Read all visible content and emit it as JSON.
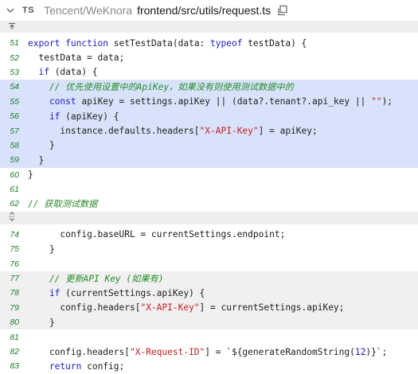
{
  "header": {
    "lang_badge": "TS",
    "repo": "Tencent/WeKnora",
    "path": "frontend/src/utils/request.ts"
  },
  "code": [
    {
      "num": "51",
      "hl": "none",
      "segs": [
        [
          "kw",
          "export function "
        ],
        [
          "",
          "setTestData(data: "
        ],
        [
          "kw",
          "typeof"
        ],
        [
          "",
          " testData) {"
        ]
      ]
    },
    {
      "num": "52",
      "hl": "none",
      "segs": [
        [
          "",
          "  testData = data;"
        ]
      ]
    },
    {
      "num": "53",
      "hl": "none",
      "segs": [
        [
          "kw",
          "  if"
        ],
        [
          "",
          " (data) {"
        ]
      ]
    },
    {
      "num": "54",
      "hl": "blue",
      "segs": [
        [
          "cm",
          "    // 优先使用设置中的ApiKey，如果没有则使用测试数据中的"
        ]
      ]
    },
    {
      "num": "55",
      "hl": "blue",
      "segs": [
        [
          "kw",
          "    const"
        ],
        [
          "",
          " apiKey = settings.apiKey || (data?.tenant?.api_key || "
        ],
        [
          "str",
          "\"\""
        ],
        [
          "",
          ");"
        ]
      ]
    },
    {
      "num": "56",
      "hl": "blue",
      "segs": [
        [
          "kw",
          "    if"
        ],
        [
          "",
          " (apiKey) {"
        ]
      ]
    },
    {
      "num": "57",
      "hl": "blue",
      "segs": [
        [
          "",
          "      instance.defaults.headers["
        ],
        [
          "str",
          "\"X-API-Key\""
        ],
        [
          "",
          "] = apiKey;"
        ]
      ]
    },
    {
      "num": "58",
      "hl": "blue",
      "segs": [
        [
          "",
          "    }"
        ]
      ]
    },
    {
      "num": "59",
      "hl": "blue",
      "segs": [
        [
          "",
          "  }"
        ]
      ]
    },
    {
      "num": "60",
      "hl": "none",
      "segs": [
        [
          "",
          "}"
        ]
      ]
    },
    {
      "num": "61",
      "hl": "none",
      "segs": [
        [
          "",
          ""
        ]
      ]
    },
    {
      "num": "62",
      "hl": "none",
      "segs": [
        [
          "cm",
          "// 获取测试数据"
        ]
      ]
    }
  ],
  "code2": [
    {
      "num": "74",
      "hl": "none",
      "segs": [
        [
          "",
          "      config.baseURL = currentSettings.endpoint;"
        ]
      ]
    },
    {
      "num": "75",
      "hl": "none",
      "segs": [
        [
          "",
          "    }"
        ]
      ]
    },
    {
      "num": "76",
      "hl": "none",
      "segs": [
        [
          "",
          ""
        ]
      ]
    },
    {
      "num": "77",
      "hl": "gray",
      "segs": [
        [
          "cm",
          "    // 更新API Key (如果有)"
        ]
      ]
    },
    {
      "num": "78",
      "hl": "gray",
      "segs": [
        [
          "kw",
          "    if"
        ],
        [
          "",
          " (currentSettings.apiKey) {"
        ]
      ]
    },
    {
      "num": "79",
      "hl": "gray",
      "segs": [
        [
          "",
          "      config.headers["
        ],
        [
          "str",
          "\"X-API-Key\""
        ],
        [
          "",
          "] = currentSettings.apiKey;"
        ]
      ]
    },
    {
      "num": "80",
      "hl": "gray",
      "segs": [
        [
          "",
          "    }"
        ]
      ]
    },
    {
      "num": "81",
      "hl": "none",
      "segs": [
        [
          "",
          ""
        ]
      ]
    },
    {
      "num": "82",
      "hl": "none",
      "segs": [
        [
          "",
          "    config.headers["
        ],
        [
          "str",
          "\"X-Request-ID\""
        ],
        [
          "",
          "] = `${generateRandomString("
        ],
        [
          "num",
          "12"
        ],
        [
          "",
          ")}`;"
        ]
      ]
    },
    {
      "num": "83",
      "hl": "none",
      "segs": [
        [
          "kw",
          "    return"
        ],
        [
          "",
          " config;"
        ]
      ]
    }
  ]
}
